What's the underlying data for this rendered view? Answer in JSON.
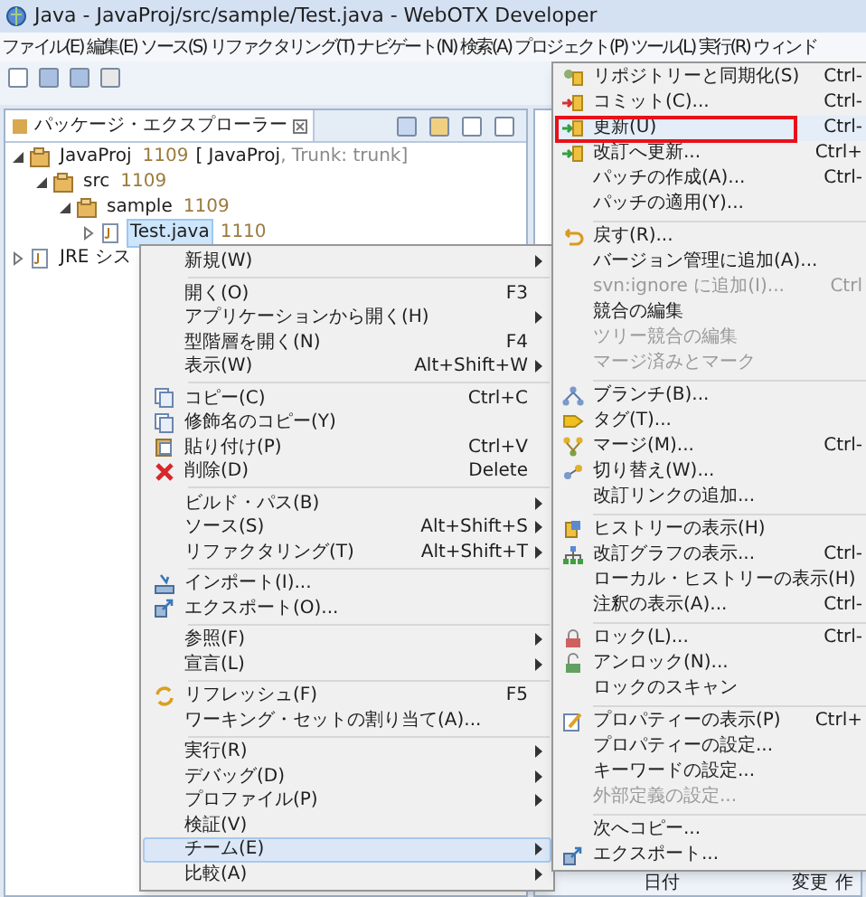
{
  "window": {
    "title": "Java - JavaProj/src/sample/Test.java - WebOTX Developer"
  },
  "menubar": [
    {
      "label": "ファイル(E)"
    },
    {
      "label": "編集(E)"
    },
    {
      "label": "ソース(S)"
    },
    {
      "label": "リファクタリング(T)"
    },
    {
      "label": "ナビゲート(N)"
    },
    {
      "label": "検索(A)"
    },
    {
      "label": "プロジェクト(P)"
    },
    {
      "label": "ツール(L)"
    },
    {
      "label": "実行(R)"
    },
    {
      "label": "ウィンド"
    }
  ],
  "explorer": {
    "tab": "パッケージ・エクスプローラー",
    "tree": [
      {
        "label": "JavaProj",
        "revision": "1109",
        "repo": "[ JavaProj",
        "repo_detail": ", Trunk: trunk]",
        "expanded": true,
        "selected": false,
        "children": [
          {
            "label": "src",
            "revision": "1109",
            "expanded": true,
            "selected": false,
            "children": [
              {
                "label": "sample",
                "revision": "1109",
                "expanded": true,
                "selected": false,
                "children": [
                  {
                    "label": "Test.java",
                    "revision": "1110",
                    "expanded": false,
                    "selected": true
                  }
                ]
              }
            ]
          }
        ]
      },
      {
        "label": "JRE シス",
        "expanded": false,
        "selected": false
      }
    ]
  },
  "context_menu": {
    "items": [
      {
        "kind": "item",
        "label": "新規(W)",
        "submenu": true,
        "selected": false
      },
      {
        "kind": "separator"
      },
      {
        "kind": "item",
        "label": "開く(O)",
        "shortcut": "F3",
        "submenu": false,
        "selected": false
      },
      {
        "kind": "item",
        "label": "アプリケーションから開く(H)",
        "submenu": true,
        "selected": false
      },
      {
        "kind": "item",
        "label": "型階層を開く(N)",
        "shortcut": "F4",
        "submenu": false,
        "selected": false
      },
      {
        "kind": "item",
        "label": "表示(W)",
        "shortcut": "Alt+Shift+W",
        "submenu": true,
        "selected": false
      },
      {
        "kind": "separator"
      },
      {
        "kind": "item",
        "label": "コピー(C)",
        "shortcut": "Ctrl+C",
        "submenu": false,
        "selected": false
      },
      {
        "kind": "item",
        "label": "修飾名のコピー(Y)",
        "submenu": false,
        "selected": false
      },
      {
        "kind": "item",
        "label": "貼り付け(P)",
        "shortcut": "Ctrl+V",
        "submenu": false,
        "selected": false
      },
      {
        "kind": "item",
        "label": "削除(D)",
        "shortcut": "Delete",
        "submenu": false,
        "selected": false
      },
      {
        "kind": "separator"
      },
      {
        "kind": "item",
        "label": "ビルド・パス(B)",
        "submenu": true,
        "selected": false
      },
      {
        "kind": "item",
        "label": "ソース(S)",
        "shortcut": "Alt+Shift+S",
        "submenu": true,
        "selected": false
      },
      {
        "kind": "item",
        "label": "リファクタリング(T)",
        "shortcut": "Alt+Shift+T",
        "submenu": true,
        "selected": false
      },
      {
        "kind": "separator"
      },
      {
        "kind": "item",
        "label": "インポート(I)...",
        "submenu": false,
        "selected": false
      },
      {
        "kind": "item",
        "label": "エクスポート(O)...",
        "submenu": false,
        "selected": false
      },
      {
        "kind": "separator"
      },
      {
        "kind": "item",
        "label": "参照(F)",
        "submenu": true,
        "selected": false
      },
      {
        "kind": "item",
        "label": "宣言(L)",
        "submenu": true,
        "selected": false
      },
      {
        "kind": "separator"
      },
      {
        "kind": "item",
        "label": "リフレッシュ(F)",
        "shortcut": "F5",
        "submenu": false,
        "selected": false
      },
      {
        "kind": "item",
        "label": "ワーキング・セットの割り当て(A)...",
        "submenu": false,
        "selected": false
      },
      {
        "kind": "separator"
      },
      {
        "kind": "item",
        "label": "実行(R)",
        "submenu": true,
        "selected": false
      },
      {
        "kind": "item",
        "label": "デバッグ(D)",
        "submenu": true,
        "selected": false
      },
      {
        "kind": "item",
        "label": "プロファイル(P)",
        "submenu": true,
        "selected": false
      },
      {
        "kind": "item",
        "label": "検証(V)",
        "submenu": false,
        "selected": false
      },
      {
        "kind": "item",
        "label": "チーム(E)",
        "submenu": true,
        "selected": true
      },
      {
        "kind": "item",
        "label": "比較(A)",
        "submenu": true,
        "selected": false
      }
    ]
  },
  "team_menu": {
    "items": [
      {
        "kind": "item",
        "label": "リポジトリーと同期化(S)",
        "shortcut": "Ctrl-",
        "selected": false,
        "disabled": false
      },
      {
        "kind": "item",
        "label": "コミット(C)...",
        "shortcut": "Ctrl-",
        "selected": false,
        "disabled": false
      },
      {
        "kind": "item",
        "label": "更新(U)",
        "shortcut": "Ctrl-",
        "selected": true,
        "disabled": false
      },
      {
        "kind": "item",
        "label": "改訂へ更新...",
        "shortcut": "Ctrl+",
        "selected": false,
        "disabled": false
      },
      {
        "kind": "item",
        "label": "パッチの作成(A)...",
        "shortcut": "Ctrl-",
        "selected": false,
        "disabled": false
      },
      {
        "kind": "item",
        "label": "パッチの適用(Y)...",
        "selected": false,
        "disabled": false
      },
      {
        "kind": "separator"
      },
      {
        "kind": "item",
        "label": "戻す(R)...",
        "selected": false,
        "disabled": false
      },
      {
        "kind": "item",
        "label": "バージョン管理に追加(A)...",
        "selected": false,
        "disabled": false
      },
      {
        "kind": "item",
        "label": "svn:ignore に追加(I)...",
        "shortcut": "Ctrl",
        "selected": false,
        "disabled": true
      },
      {
        "kind": "item",
        "label": "競合の編集",
        "selected": false,
        "disabled": false
      },
      {
        "kind": "item",
        "label": "ツリー競合の編集",
        "selected": false,
        "disabled": true
      },
      {
        "kind": "item",
        "label": "マージ済みとマーク",
        "selected": false,
        "disabled": true
      },
      {
        "kind": "separator"
      },
      {
        "kind": "item",
        "label": "ブランチ(B)...",
        "selected": false,
        "disabled": false
      },
      {
        "kind": "item",
        "label": "タグ(T)...",
        "selected": false,
        "disabled": false
      },
      {
        "kind": "item",
        "label": "マージ(M)...",
        "shortcut": "Ctrl-",
        "selected": false,
        "disabled": false
      },
      {
        "kind": "item",
        "label": "切り替え(W)...",
        "selected": false,
        "disabled": false
      },
      {
        "kind": "item",
        "label": "改訂リンクの追加...",
        "selected": false,
        "disabled": false
      },
      {
        "kind": "separator"
      },
      {
        "kind": "item",
        "label": "ヒストリーの表示(H)",
        "selected": false,
        "disabled": false
      },
      {
        "kind": "item",
        "label": "改訂グラフの表示...",
        "shortcut": "Ctrl-",
        "selected": false,
        "disabled": false
      },
      {
        "kind": "item",
        "label": "ローカル・ヒストリーの表示(H)",
        "selected": false,
        "disabled": false
      },
      {
        "kind": "item",
        "label": "注釈の表示(A)...",
        "shortcut": "Ctrl-",
        "selected": false,
        "disabled": false
      },
      {
        "kind": "separator"
      },
      {
        "kind": "item",
        "label": "ロック(L)...",
        "shortcut": "Ctrl-",
        "selected": false,
        "disabled": false
      },
      {
        "kind": "item",
        "label": "アンロック(N)...",
        "selected": false,
        "disabled": false
      },
      {
        "kind": "item",
        "label": "ロックのスキャン",
        "selected": false,
        "disabled": false
      },
      {
        "kind": "separator"
      },
      {
        "kind": "item",
        "label": "プロパティーの表示(P)",
        "shortcut": "Ctrl+",
        "selected": false,
        "disabled": false
      },
      {
        "kind": "item",
        "label": "プロパティーの設定...",
        "selected": false,
        "disabled": false
      },
      {
        "kind": "item",
        "label": "キーワードの設定...",
        "selected": false,
        "disabled": false
      },
      {
        "kind": "item",
        "label": "外部定義の設定...",
        "selected": false,
        "disabled": true
      },
      {
        "kind": "separator"
      },
      {
        "kind": "item",
        "label": "次へコピー...",
        "selected": false,
        "disabled": false
      },
      {
        "kind": "item",
        "label": "エクスポート...",
        "selected": false,
        "disabled": false
      }
    ]
  },
  "history_table": {
    "columns": [
      "日付",
      "変更",
      "作"
    ]
  }
}
